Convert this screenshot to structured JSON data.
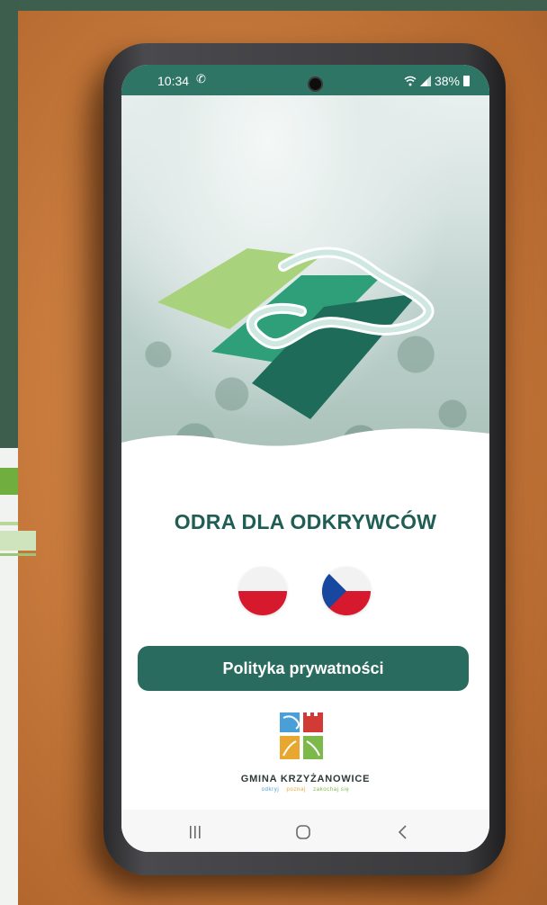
{
  "status_bar": {
    "time": "10:34",
    "battery": "38%",
    "call_icon": "phone-call-icon",
    "wifi_icon": "wifi-icon",
    "signal_icon": "signal-icon"
  },
  "app": {
    "title": "ODRA DLA ODKRYWCÓW",
    "languages": [
      {
        "code": "pl",
        "icon": "poland-flag-icon"
      },
      {
        "code": "cz",
        "icon": "czech-flag-icon"
      }
    ],
    "privacy_button": "Polityka prywatności"
  },
  "footer": {
    "name": "GMINA KRZYŻANOWICE",
    "tagline": [
      "odkryj",
      "poznaj",
      "zakochaj się"
    ],
    "tagline_colors": [
      "#4a9fd8",
      "#e8a830",
      "#7cb94a"
    ]
  },
  "nav": {
    "recent_icon": "recent-apps-icon",
    "home_icon": "home-icon",
    "back_icon": "back-icon"
  },
  "colors": {
    "accent": "#2a6b60",
    "status_bar": "#2f7566",
    "title": "#1f5e54"
  }
}
